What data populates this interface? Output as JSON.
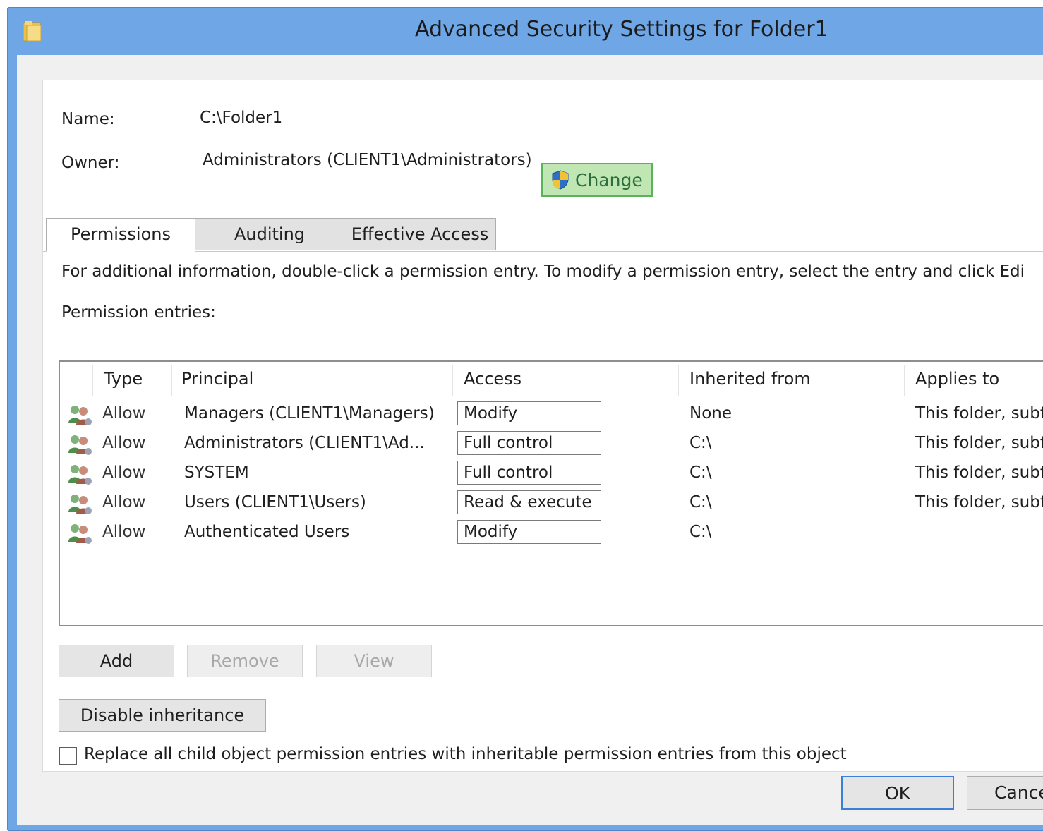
{
  "window": {
    "title": "Advanced Security Settings for Folder1",
    "title_icon": "folder-icon",
    "accent_color": "#6fa6e6"
  },
  "info": {
    "name_label": "Name:",
    "name_value": "C:\\Folder1",
    "owner_label": "Owner:",
    "owner_value": "Administrators (CLIENT1\\Administrators)",
    "change_label": "Change",
    "change_icon": "uac-shield-icon"
  },
  "tabs": [
    {
      "label": "Permissions",
      "active": true
    },
    {
      "label": "Auditing",
      "active": false
    },
    {
      "label": "Effective Access",
      "active": false
    }
  ],
  "instructions": "For additional information, double-click a permission entry. To modify a permission entry, select the entry and click Edi",
  "entries_label": "Permission entries:",
  "table": {
    "columns": [
      "Type",
      "Principal",
      "Access",
      "Inherited from",
      "Applies to"
    ],
    "rows": [
      {
        "type": "Allow",
        "principal": "Managers (CLIENT1\\Managers)",
        "access": "Modify",
        "inherited": "None",
        "applies": "This folder, subf"
      },
      {
        "type": "Allow",
        "principal": "Administrators (CLIENT1\\Ad...",
        "access": "Full control",
        "inherited": "C:\\",
        "applies": "This folder, subf"
      },
      {
        "type": "Allow",
        "principal": "SYSTEM",
        "access": "Full control",
        "inherited": "C:\\",
        "applies": "This folder, subf"
      },
      {
        "type": "Allow",
        "principal": "Users (CLIENT1\\Users)",
        "access": "Read & execute",
        "inherited": "C:\\",
        "applies": "This folder, subf"
      },
      {
        "type": "Allow",
        "principal": "Authenticated Users",
        "access": "Modify",
        "inherited": "C:\\",
        "applies": ""
      }
    ],
    "row_icon": "users-group-icon"
  },
  "buttons": {
    "add": "Add",
    "remove": "Remove",
    "view": "View",
    "disable_inheritance": "Disable inheritance"
  },
  "replace_checkbox": {
    "label": "Replace all child object permission entries with inheritable permission entries from this object",
    "checked": false
  },
  "footer": {
    "ok": "OK",
    "cancel": "Cance"
  }
}
